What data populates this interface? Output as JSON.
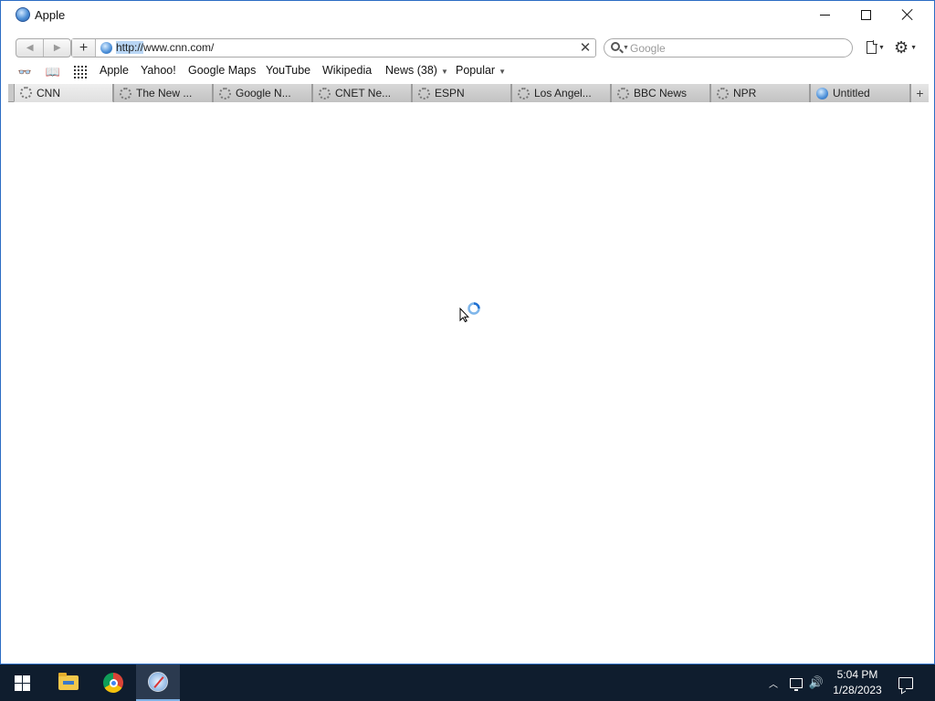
{
  "window": {
    "title": "Apple",
    "icon": "safari-globe-icon"
  },
  "toolbar": {
    "url_selected": "http://",
    "url_rest": "www.cnn.com/",
    "search_placeholder": "Google",
    "back_icon": "back-arrow-icon",
    "forward_icon": "forward-arrow-icon"
  },
  "bookmarks": {
    "items": [
      {
        "label": "Apple"
      },
      {
        "label": "Yahoo!"
      },
      {
        "label": "Google Maps"
      },
      {
        "label": "YouTube"
      },
      {
        "label": "Wikipedia"
      },
      {
        "label": "News (38)",
        "has_menu": true
      },
      {
        "label": "Popular",
        "has_menu": true
      }
    ]
  },
  "tabs": [
    {
      "label": "CNN",
      "loading": true,
      "active": true
    },
    {
      "label": "The New ...",
      "loading": true
    },
    {
      "label": "Google N...",
      "loading": true
    },
    {
      "label": "CNET Ne...",
      "loading": true
    },
    {
      "label": "ESPN",
      "loading": true
    },
    {
      "label": "Los Angel...",
      "loading": true
    },
    {
      "label": "BBC News",
      "loading": true
    },
    {
      "label": "NPR",
      "loading": true
    },
    {
      "label": "Untitled",
      "loading": false
    }
  ],
  "taskbar": {
    "time": "5:04 PM",
    "date": "1/28/2023",
    "apps": [
      "windows-start",
      "file-explorer",
      "chrome",
      "safari"
    ]
  },
  "colors": {
    "accent": "#2b6cc4",
    "selection": "#b9d6f5",
    "taskbar": "#0f1d2e"
  }
}
